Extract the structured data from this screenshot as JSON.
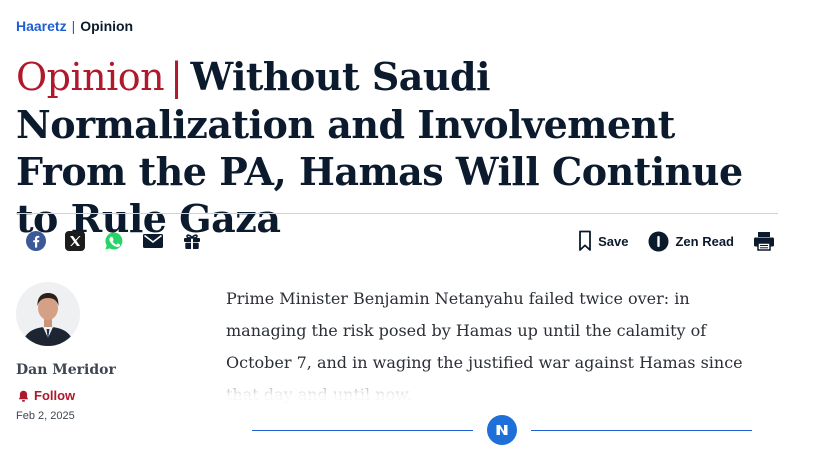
{
  "breadcrumb": {
    "home": "Haaretz",
    "separator": "|",
    "section": "Opinion"
  },
  "headline": {
    "kicker": "Opinion",
    "separator": "|",
    "title": "Without Saudi Normalization and Involvement From the PA, Hamas Will Continue to Rule Gaza"
  },
  "share": {
    "items": [
      {
        "icon": "facebook-icon",
        "color": "#3b5998"
      },
      {
        "icon": "x-icon",
        "color": "#1c1c1c"
      },
      {
        "icon": "whatsapp-icon",
        "color": "#25d366"
      },
      {
        "icon": "mail-icon",
        "color": "#0b1a2c"
      },
      {
        "icon": "gift-icon",
        "color": "#0b1a2c"
      }
    ]
  },
  "tools": {
    "save_label": "Save",
    "zen_label": "Zen Read",
    "print_icon": "print-icon"
  },
  "author": {
    "name": "Dan Meridor",
    "follow_label": "Follow",
    "date": "Feb 2, 2025"
  },
  "article": {
    "lead": "Prime Minister Benjamin Netanyahu failed twice over: in managing the risk posed by Hamas up until the calamity of October 7, and in waging the justified war against Hamas since that day and until now."
  },
  "colors": {
    "brand_blue": "#1f5fd6",
    "opinion_red": "#b0182b",
    "text_dark": "#0b1a2c"
  }
}
